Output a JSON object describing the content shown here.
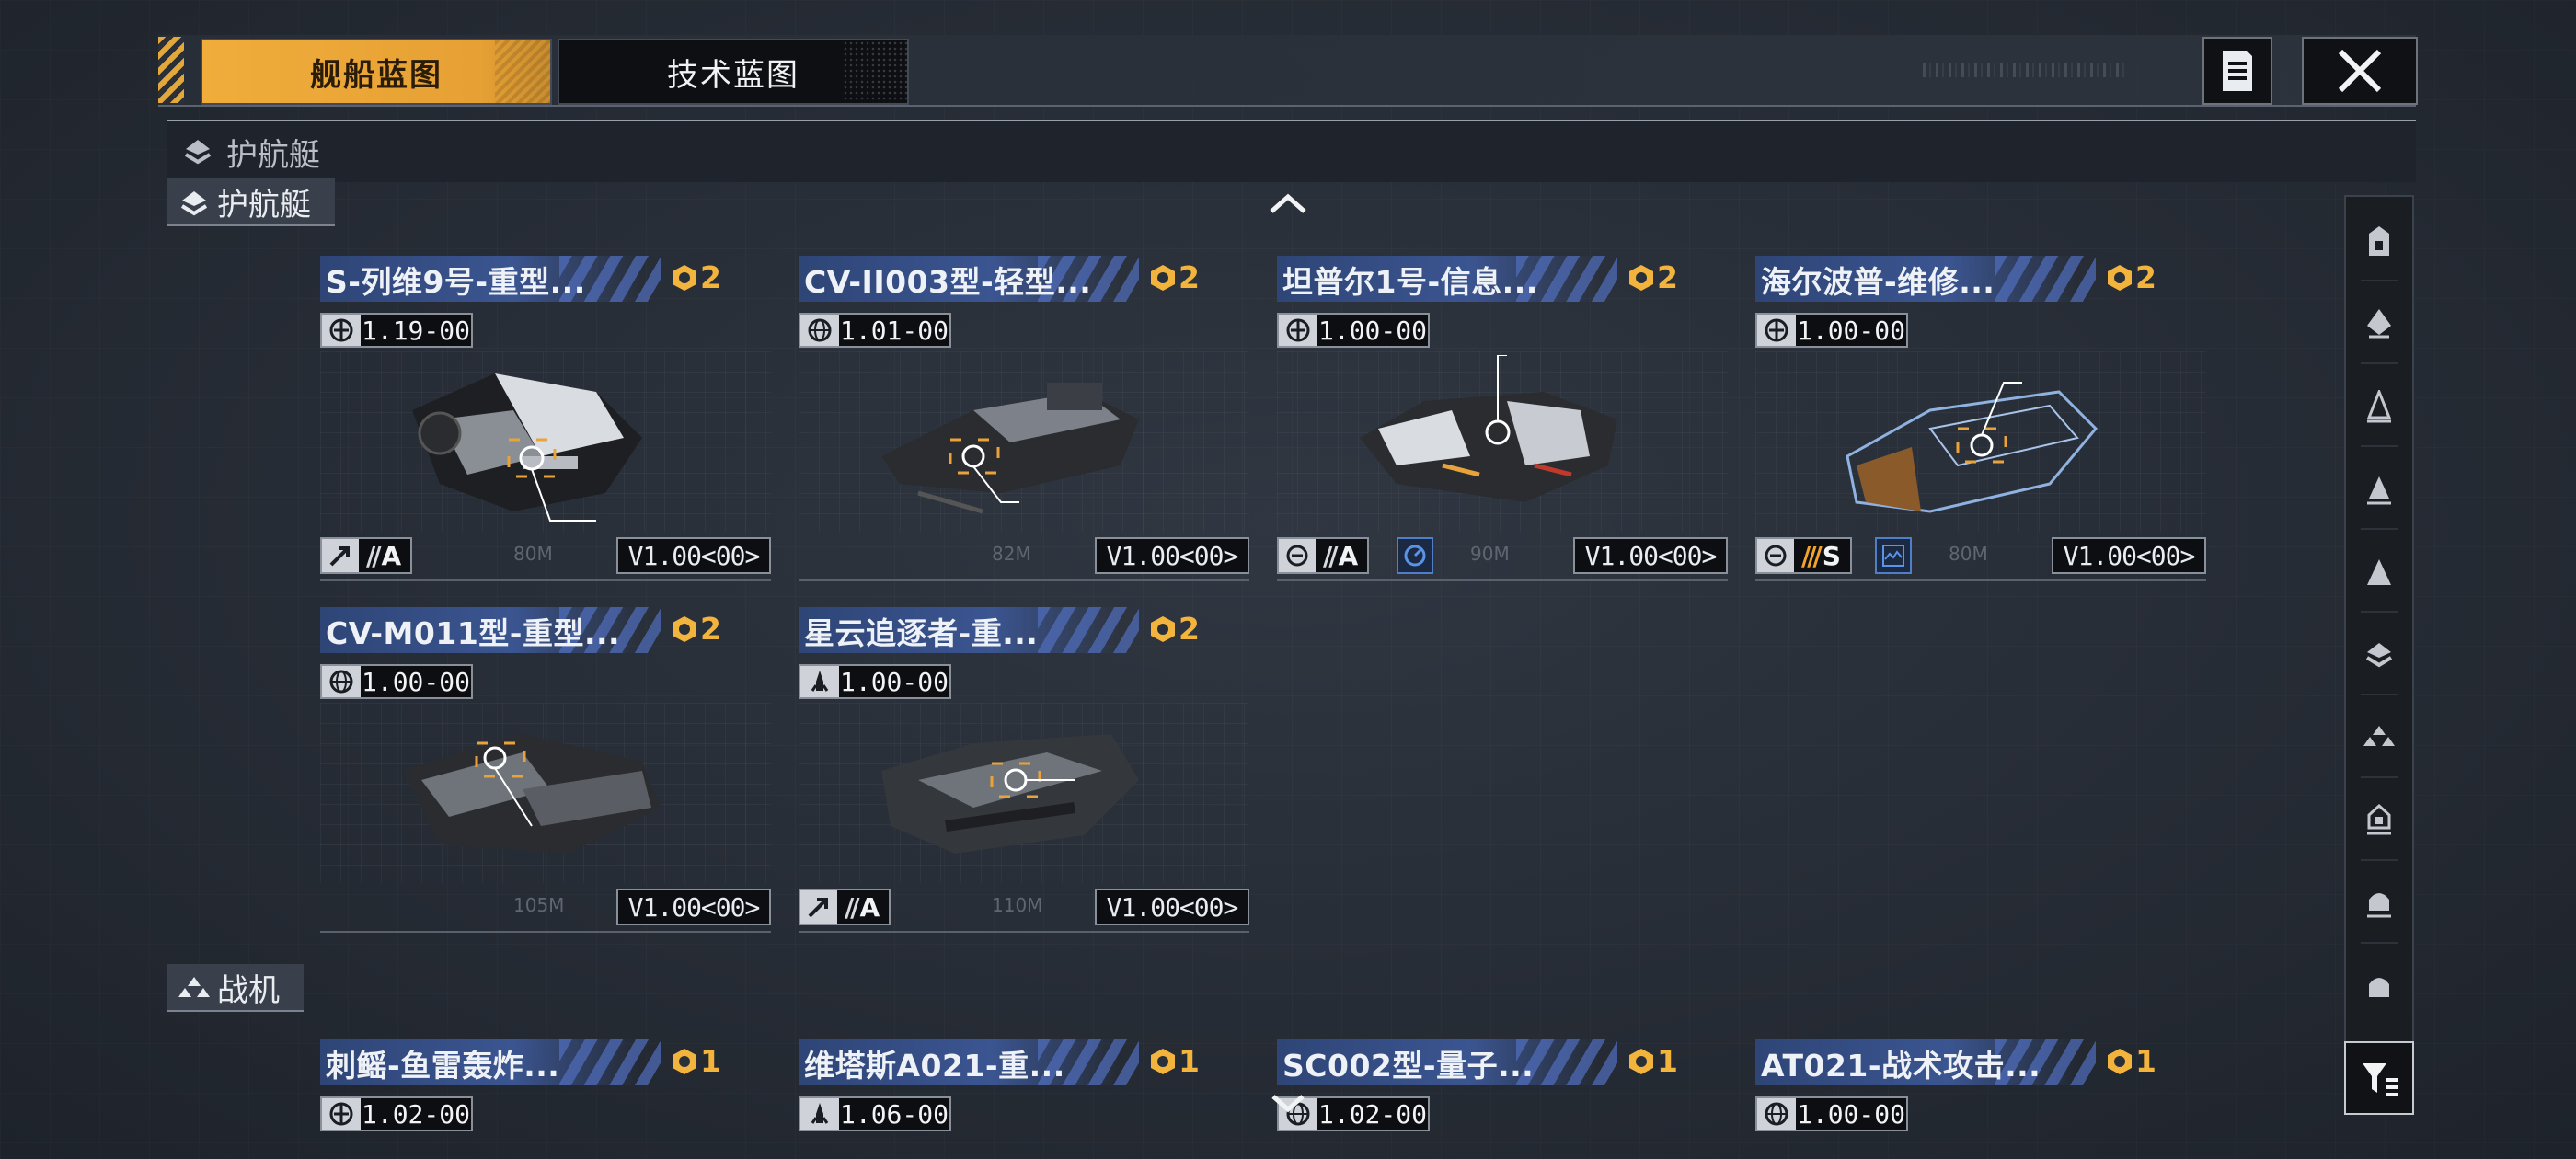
{
  "tabs": [
    {
      "label": "舰船蓝图",
      "active": true
    },
    {
      "label": "技术蓝图",
      "active": false
    }
  ],
  "section_header": "护航艇",
  "categories": {
    "escort": "护航艇",
    "fighter": "战机"
  },
  "accent_color": "#f0ad3a",
  "cards": [
    {
      "title": "S-列维9号-重型...",
      "cost": "2",
      "version": "1.19-00",
      "length": "80M",
      "role_icon": "attack-arrow-icon",
      "grade": "A",
      "grade_slashes": "//",
      "blueprint_version": "V1.00<00>"
    },
    {
      "title": "CV-II003型-轻型...",
      "cost": "2",
      "version": "1.01-00",
      "length": "82M",
      "role_icon": "",
      "grade": "",
      "grade_slashes": "",
      "blueprint_version": "V1.00<00>"
    },
    {
      "title": "坦普尔1号-信息...",
      "cost": "2",
      "version": "1.00-00",
      "length": "90M",
      "role_icon": "target-ring-icon",
      "grade": "A",
      "grade_slashes": "//",
      "extra_icon": "radar-sweep-icon",
      "blueprint_version": "V1.00<00>"
    },
    {
      "title": "海尔波普-维修...",
      "cost": "2",
      "version": "1.00-00",
      "length": "80M",
      "role_icon": "target-ring-icon",
      "grade": "S",
      "grade_slashes": "///",
      "extra_icon": "repair-wave-icon",
      "blueprint_version": "V1.00<00>"
    },
    {
      "title": "CV-M011型-重型...",
      "cost": "2",
      "version": "1.00-00",
      "length": "105M",
      "role_icon": "",
      "grade": "",
      "grade_slashes": "",
      "blueprint_version": "V1.00<00>"
    },
    {
      "title": "星云追逐者-重...",
      "cost": "2",
      "version": "1.00-00",
      "length": "110M",
      "role_icon": "attack-arrow-icon",
      "grade": "A",
      "grade_slashes": "//",
      "blueprint_version": "V1.00<00>"
    }
  ],
  "fighter_cards": [
    {
      "title": "刺鳐-鱼雷轰炸...",
      "cost": "1",
      "version": "1.02-00"
    },
    {
      "title": "维塔斯A021-重...",
      "cost": "1",
      "version": "1.06-00"
    },
    {
      "title": "SC002型-量子...",
      "cost": "1",
      "version": "1.02-00"
    },
    {
      "title": "AT021-战术攻击...",
      "cost": "1",
      "version": "1.00-00"
    }
  ]
}
